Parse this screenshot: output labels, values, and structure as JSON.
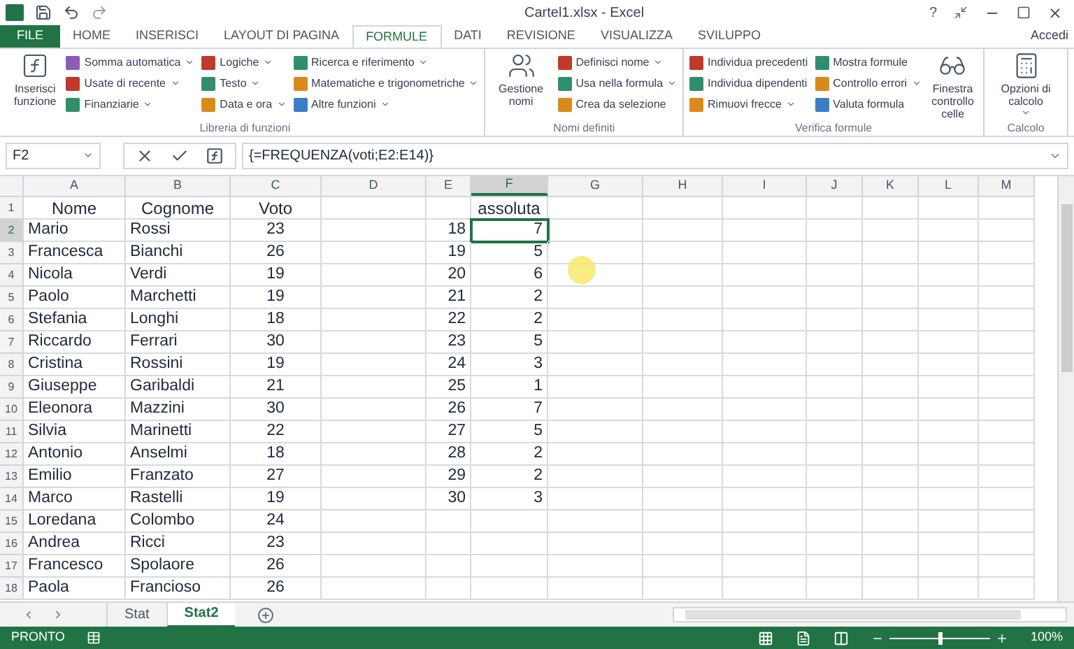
{
  "window": {
    "title": "Cartel1.xlsx - Excel",
    "help": "?"
  },
  "tabs": [
    {
      "label": "FILE",
      "kind": "file",
      "selected": false
    },
    {
      "label": "HOME",
      "kind": "tab",
      "selected": false
    },
    {
      "label": "INSERISCI",
      "kind": "tab",
      "selected": false
    },
    {
      "label": "LAYOUT DI PAGINA",
      "kind": "tab",
      "selected": false
    },
    {
      "label": "FORMULE",
      "kind": "tab",
      "selected": true
    },
    {
      "label": "DATI",
      "kind": "tab",
      "selected": false
    },
    {
      "label": "REVISIONE",
      "kind": "tab",
      "selected": false
    },
    {
      "label": "VISUALIZZA",
      "kind": "tab",
      "selected": false
    },
    {
      "label": "SVILUPPO",
      "kind": "tab",
      "selected": false
    }
  ],
  "account": "Accedi",
  "ribbon": {
    "groups": [
      {
        "label": "Libreria di funzioni",
        "items": [
          {
            "kind": "large",
            "label": "Inserisci funzione",
            "dropdown": false
          },
          {
            "kind": "column",
            "items": [
              {
                "label": "Somma automatica",
                "dropdown": true
              },
              {
                "label": "Usate di recente",
                "dropdown": true
              },
              {
                "label": "Finanziarie",
                "dropdown": true
              }
            ]
          },
          {
            "kind": "column",
            "items": [
              {
                "label": "Logiche",
                "dropdown": true
              },
              {
                "label": "Testo",
                "dropdown": true
              },
              {
                "label": "Data e ora",
                "dropdown": true
              }
            ]
          },
          {
            "kind": "column",
            "items": [
              {
                "label": "Ricerca e riferimento",
                "dropdown": true
              },
              {
                "label": "Matematiche e trigonometriche",
                "dropdown": true
              },
              {
                "label": "Altre funzioni",
                "dropdown": true
              }
            ]
          }
        ]
      },
      {
        "label": "Nomi definiti",
        "items": [
          {
            "kind": "large",
            "label": "Gestione nomi",
            "dropdown": false
          },
          {
            "kind": "column",
            "items": [
              {
                "label": "Definisci nome",
                "dropdown": true
              },
              {
                "label": "Usa nella formula",
                "dropdown": true
              },
              {
                "label": "Crea da selezione",
                "dropdown": false
              }
            ]
          }
        ]
      },
      {
        "label": "Verifica formule",
        "items": [
          {
            "kind": "column",
            "items": [
              {
                "label": "Individua precedenti",
                "dropdown": false
              },
              {
                "label": "Individua dipendenti",
                "dropdown": false
              },
              {
                "label": "Rimuovi frecce",
                "dropdown": true
              }
            ]
          },
          {
            "kind": "column",
            "items": [
              {
                "label": "Mostra formule",
                "dropdown": false
              },
              {
                "label": "Controllo errori",
                "dropdown": true
              },
              {
                "label": "Valuta formula",
                "dropdown": false
              }
            ]
          },
          {
            "kind": "large",
            "label": "Finestra controllo celle",
            "dropdown": false
          }
        ]
      },
      {
        "label": "Calcolo",
        "items": [
          {
            "kind": "large",
            "label": "Opzioni di calcolo",
            "dropdown": true
          }
        ]
      }
    ]
  },
  "formula_bar": {
    "name_box": "F2",
    "formula": "{=FREQUENZA(voti;E2:E14)}"
  },
  "columns": [
    {
      "label": "A",
      "selected": false
    },
    {
      "label": "B",
      "selected": false
    },
    {
      "label": "C",
      "selected": false
    },
    {
      "label": "D",
      "selected": false
    },
    {
      "label": "E",
      "selected": false
    },
    {
      "label": "F",
      "selected": true
    },
    {
      "label": "G",
      "selected": false
    },
    {
      "label": "H",
      "selected": false
    },
    {
      "label": "I",
      "selected": false
    },
    {
      "label": "J",
      "selected": false
    },
    {
      "label": "K",
      "selected": false
    },
    {
      "label": "L",
      "selected": false
    },
    {
      "label": "M",
      "selected": false
    }
  ],
  "rows": [
    {
      "number": "1",
      "selected": false,
      "cells": [
        "Nome",
        "Cognome",
        "Voto",
        "",
        "",
        "assoluta"
      ]
    },
    {
      "number": "2",
      "selected": true,
      "cells": [
        "Mario",
        "Rossi",
        "23",
        "",
        "18",
        "7"
      ]
    },
    {
      "number": "3",
      "selected": false,
      "cells": [
        "Francesca",
        "Bianchi",
        "26",
        "",
        "19",
        "5"
      ]
    },
    {
      "number": "4",
      "selected": false,
      "cells": [
        "Nicola",
        "Verdi",
        "19",
        "",
        "20",
        "6"
      ]
    },
    {
      "number": "5",
      "selected": false,
      "cells": [
        "Paolo",
        "Marchetti",
        "19",
        "",
        "21",
        "2"
      ]
    },
    {
      "number": "6",
      "selected": false,
      "cells": [
        "Stefania",
        "Longhi",
        "18",
        "",
        "22",
        "2"
      ]
    },
    {
      "number": "7",
      "selected": false,
      "cells": [
        "Riccardo",
        "Ferrari",
        "30",
        "",
        "23",
        "5"
      ]
    },
    {
      "number": "8",
      "selected": false,
      "cells": [
        "Cristina",
        "Rossini",
        "19",
        "",
        "24",
        "3"
      ]
    },
    {
      "number": "9",
      "selected": false,
      "cells": [
        "Giuseppe",
        "Garibaldi",
        "21",
        "",
        "25",
        "1"
      ]
    },
    {
      "number": "10",
      "selected": false,
      "cells": [
        "Eleonora",
        "Mazzini",
        "30",
        "",
        "26",
        "7"
      ]
    },
    {
      "number": "11",
      "selected": false,
      "cells": [
        "Silvia",
        "Marinetti",
        "22",
        "",
        "27",
        "5"
      ]
    },
    {
      "number": "12",
      "selected": false,
      "cells": [
        "Antonio",
        "Anselmi",
        "18",
        "",
        "28",
        "2"
      ]
    },
    {
      "number": "13",
      "selected": false,
      "cells": [
        "Emilio",
        "Franzato",
        "27",
        "",
        "29",
        "2"
      ]
    },
    {
      "number": "14",
      "selected": false,
      "cells": [
        "Marco",
        "Rastelli",
        "19",
        "",
        "30",
        "3"
      ]
    },
    {
      "number": "15",
      "selected": false,
      "cells": [
        "Loredana",
        "Colombo",
        "24"
      ]
    },
    {
      "number": "16",
      "selected": false,
      "cells": [
        "Andrea",
        "Ricci",
        "23"
      ]
    },
    {
      "number": "17",
      "selected": false,
      "cells": [
        "Francesco",
        "Spolaore",
        "26"
      ]
    },
    {
      "number": "18",
      "selected": false,
      "cells": [
        "Paola",
        "Francioso",
        "26"
      ]
    }
  ],
  "sheets": [
    {
      "label": "Stat",
      "selected": false
    },
    {
      "label": "Stat2",
      "selected": true
    }
  ],
  "status_bar": {
    "status": "PRONTO",
    "zoom": "100%",
    "zoom_slider": {
      "level": 0.5
    }
  }
}
